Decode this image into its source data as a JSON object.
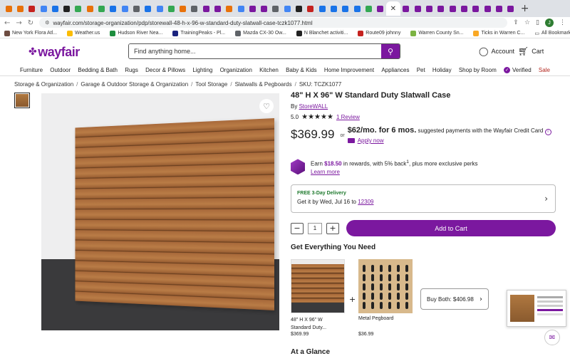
{
  "browser": {
    "url": "wayfair.com/storage-organization/pdp/storewall-48-h-x-96-w-standard-duty-slatwall-case-tczk1077.html",
    "new_tab": "+",
    "tab_favicons": [
      "#e8710a",
      "#e8710a",
      "#c5221f",
      "#4285f4",
      "#1a73e8",
      "#222222",
      "#34a853",
      "#e8710a",
      "#34a853",
      "#1a73e8",
      "#4285f4",
      "#5f6368",
      "#1a73e8",
      "#4285f4",
      "#34a853",
      "#e8710a",
      "#5f6368",
      "#7b189f",
      "#7b189f",
      "#e8710a",
      "#4285f4",
      "#7b189f",
      "#7b189f",
      "#5f6368",
      "#4285f4",
      "#222222",
      "#c5221f",
      "#1a73e8",
      "#1a73e8",
      "#1a73e8",
      "#1a73e8",
      "#34a853",
      "#7b189f",
      "#7b189f",
      "#7b189f",
      "#7b189f",
      "#7b189f",
      "#7b189f",
      "#7b189f",
      "#7b189f",
      "#7b189f",
      "#7b189f",
      "#7b189f",
      "#7b189f"
    ],
    "profile_initial": "J",
    "bookmarks": [
      {
        "label": "New York Flora Atl...",
        "color": "#6d4c41"
      },
      {
        "label": "Weather.us",
        "color": "#fbbc04"
      },
      {
        "label": "Hudson River Nea...",
        "color": "#1e8e3e"
      },
      {
        "label": "TrainingPeaks - Pl...",
        "color": "#1a237e"
      },
      {
        "label": "Mazda CX-30 Ow...",
        "color": "#5f6368"
      },
      {
        "label": "N Blanchet activiti...",
        "color": "#222222"
      },
      {
        "label": "Route09 johnny",
        "color": "#c5221f"
      },
      {
        "label": "Warren County Sn...",
        "color": "#7cb342"
      },
      {
        "label": "Ticks in Warren C...",
        "color": "#f9a825"
      }
    ],
    "all_bookmarks": "All Bookmarks"
  },
  "header": {
    "logo": "wayfair",
    "search_placeholder": "Find anything home...",
    "account": "Account",
    "cart": "Cart"
  },
  "categories": [
    "Furniture",
    "Outdoor",
    "Bedding & Bath",
    "Rugs",
    "Decor & Pillows",
    "Lighting",
    "Organization",
    "Kitchen",
    "Baby & Kids",
    "Home Improvement",
    "Appliances",
    "Pet",
    "Holiday",
    "Shop by Room",
    "Verified",
    "Sale"
  ],
  "breadcrumb": [
    "Storage & Organization",
    "Garage & Outdoor Storage & Organization",
    "Tool Storage",
    "Slatwalls & Pegboards",
    "SKU: TCZK1077"
  ],
  "product": {
    "title": "48\" H X 96\" W Standard Duty Slatwall Case",
    "by_prefix": "By ",
    "brand": "StoreWALL",
    "rating_value": "5.0",
    "stars": "★★★★★",
    "reviews": "1 Review",
    "price": "$369.99",
    "or": "or",
    "finance_amount": "$62/mo. for 6 mos.",
    "finance_text": " suggested payments with the Wayfair Credit Card",
    "apply_now": "Apply now",
    "rewards_prefix": "Earn ",
    "rewards_amount": "$18.50",
    "rewards_suffix": " in rewards, with 5% back",
    "rewards_more": ", plus more exclusive perks",
    "learn_more": "Learn more",
    "delivery_badge": "FREE 3-Day Delivery",
    "delivery_prefix": "Get it by Wed, Jul 16 to ",
    "zip": "12309",
    "quantity": "1",
    "add_to_cart": "Add to Cart"
  },
  "bundle": {
    "heading": "Get Everything You Need",
    "item1_title": "48\" H X 96\" W Standard Duty...",
    "item1_price": "$369.99",
    "item2_title": "Metal Pegboard",
    "item2_price": "$36.99",
    "buy_both": "Buy Both: $406.98"
  },
  "at_a_glance": "At a Glance"
}
